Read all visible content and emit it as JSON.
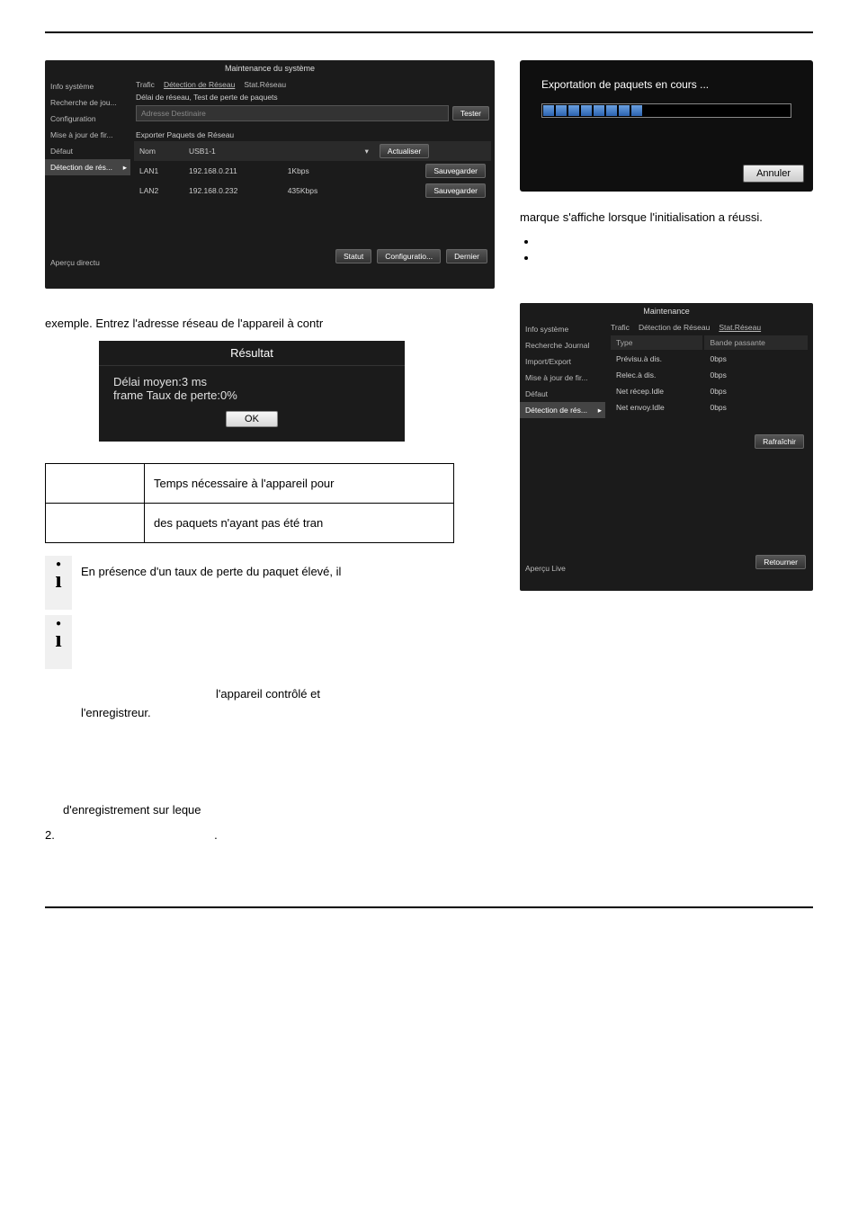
{
  "page": {
    "top_rule": true
  },
  "window1": {
    "title": "Maintenance du système",
    "sidebar": [
      "Info système",
      "Recherche de jou...",
      "Configuration",
      "Mise à jour de fir...",
      "Défaut",
      "Détection de rés..."
    ],
    "sidebar_active_index": 5,
    "live_label": "Aperçu directu",
    "tabs": [
      "Trafic",
      "Détection de Réseau",
      "Stat.Réseau"
    ],
    "tab_active_index": 1,
    "section1": "Délai de réseau, Test de perte de paquets",
    "addr_placeholder": "Adresse Destinaire",
    "test_btn": "Tester",
    "section2": "Exporter Paquets de Réseau",
    "table": {
      "headers": [
        "Nom",
        "",
        "USB1-1",
        "",
        "▾"
      ],
      "rows": [
        {
          "c0": "LAN1",
          "c1": "192.168.0.211",
          "c2": "1Kbps"
        },
        {
          "c0": "LAN2",
          "c1": "192.168.0.232",
          "c2": "435Kbps"
        }
      ],
      "refresh_btn": "Actualiser",
      "save_btn": "Sauvegarder"
    },
    "footer_btns": [
      "Statut",
      "Configuratio...",
      "Dernier"
    ]
  },
  "left_text": {
    "example_line": "exemple. Entrez l'adresse réseau de l'appareil à contr"
  },
  "result_modal": {
    "title": "Résultat",
    "line1": "Délai moyen:3 ms",
    "line2": "frame Taux de perte:0%",
    "ok": "OK"
  },
  "stats_table": {
    "row1_desc": "Temps nécessaire à l'appareil pour",
    "row2_desc": "des paquets n'ayant pas été tran"
  },
  "info_notes": {
    "note1": "En présence d'un taux de perte du paquet élevé, il",
    "note2_a": "l'appareil contrôlé et",
    "note2_b": "l'enregistreur."
  },
  "export_modal": {
    "title": "Exportation de paquets en cours ...",
    "segments": 8,
    "cancel": "Annuler"
  },
  "right_text": {
    "success_line": "marque s'affiche lorsque l'initialisation a réussi."
  },
  "window3": {
    "title": "Maintenance",
    "sidebar": [
      "Info système",
      "Recherche Journal",
      "Import/Export",
      "Mise à jour de fir...",
      "Défaut",
      "Détection de rés..."
    ],
    "sidebar_active_index": 5,
    "live_label": "Aperçu Live",
    "tabs": [
      "Trafic",
      "Détection de Réseau",
      "Stat.Réseau"
    ],
    "tab_active_index": 2,
    "bw_headers": [
      "Type",
      "Bande passante"
    ],
    "bw_rows": [
      {
        "k": "Prévisu.à dis.",
        "v": "0bps"
      },
      {
        "k": "Relec.à dis.",
        "v": "0bps"
      },
      {
        "k": "Net récep.Idle",
        "v": "0bps"
      },
      {
        "k": "Net envoy.Idle",
        "v": "0bps"
      }
    ],
    "refresh_btn": "Rafraîchir",
    "return_btn": "Retourner"
  },
  "bottom_list": {
    "line1": "d'enregistrement sur leque",
    "item2_num": "2.",
    "item2_dot": "."
  }
}
